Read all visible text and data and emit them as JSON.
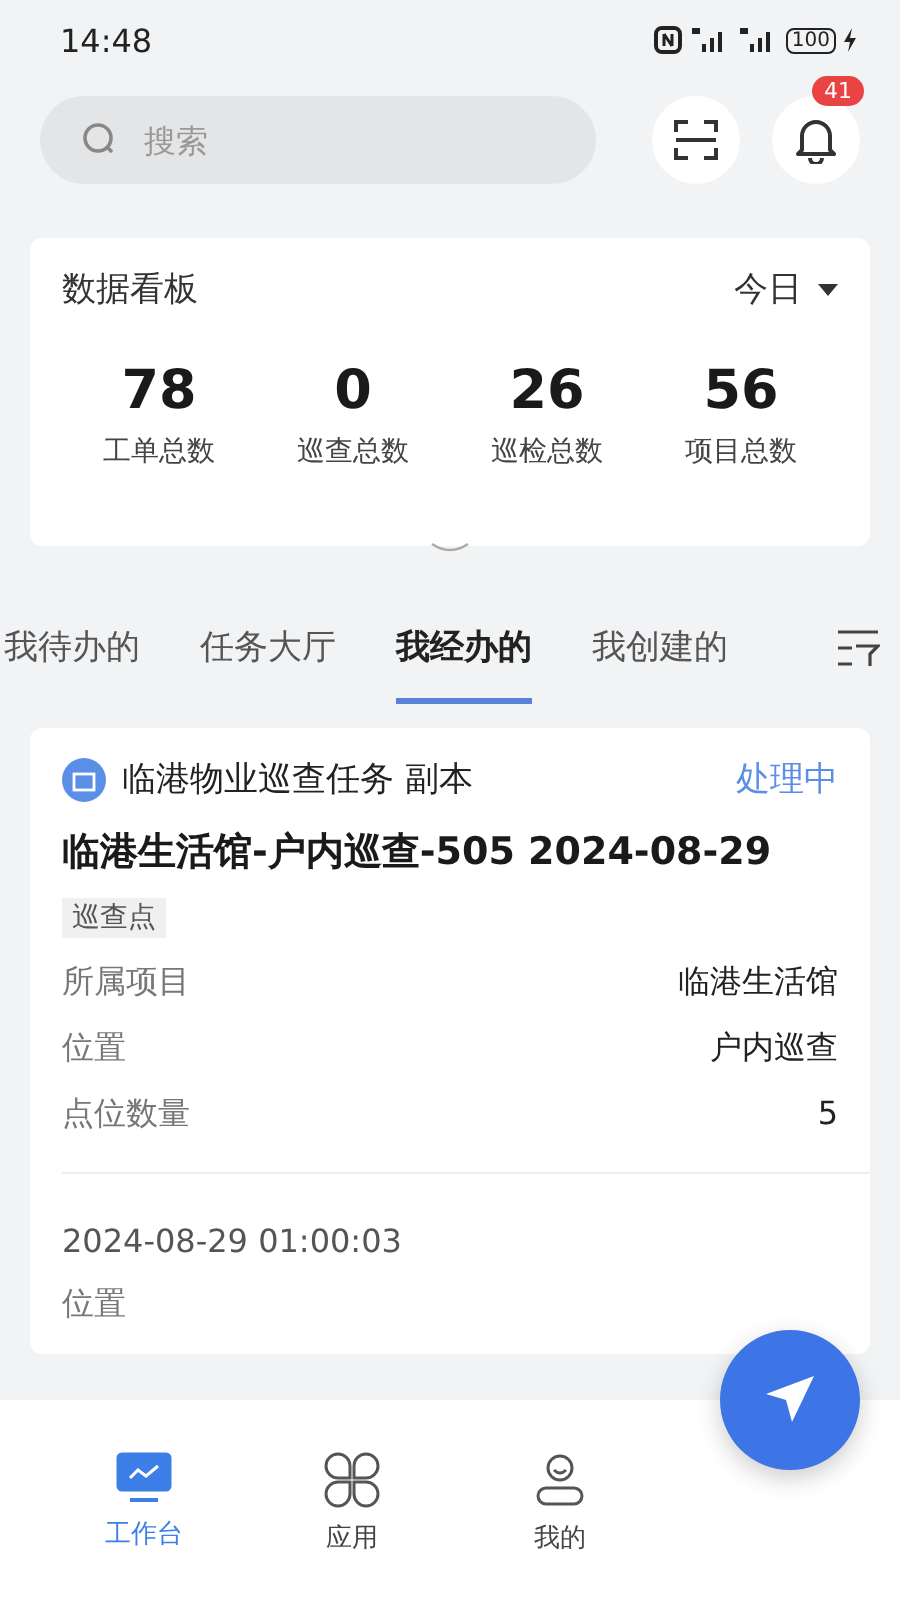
{
  "status_bar": {
    "time": "14:48",
    "battery": "100"
  },
  "search": {
    "placeholder": "搜索"
  },
  "notifications": {
    "badge": "41"
  },
  "dashboard": {
    "title": "数据看板",
    "period": "今日",
    "stats": [
      {
        "value": "78",
        "label": "工单总数"
      },
      {
        "value": "0",
        "label": "巡查总数"
      },
      {
        "value": "26",
        "label": "巡检总数"
      },
      {
        "value": "56",
        "label": "项目总数"
      }
    ]
  },
  "tabs": [
    {
      "label": "我待办的",
      "selected": false
    },
    {
      "label": "任务大厅",
      "selected": false
    },
    {
      "label": "我经办的",
      "selected": true
    },
    {
      "label": "我创建的",
      "selected": false
    }
  ],
  "task": {
    "source": "临港物业巡查任务 副本",
    "status": "处理中",
    "title": "临港生活馆-户内巡查-505 2024-08-29",
    "tag": "巡查点",
    "fields": [
      {
        "label": "所属项目",
        "value": "临港生活馆"
      },
      {
        "label": "位置",
        "value": "户内巡查"
      },
      {
        "label": "点位数量",
        "value": "5"
      }
    ],
    "record": {
      "time": "2024-08-29 01:00:03",
      "label": "位置"
    }
  },
  "bottom_nav": [
    {
      "label": "工作台",
      "selected": true
    },
    {
      "label": "应用",
      "selected": false
    },
    {
      "label": "我的",
      "selected": false
    }
  ]
}
